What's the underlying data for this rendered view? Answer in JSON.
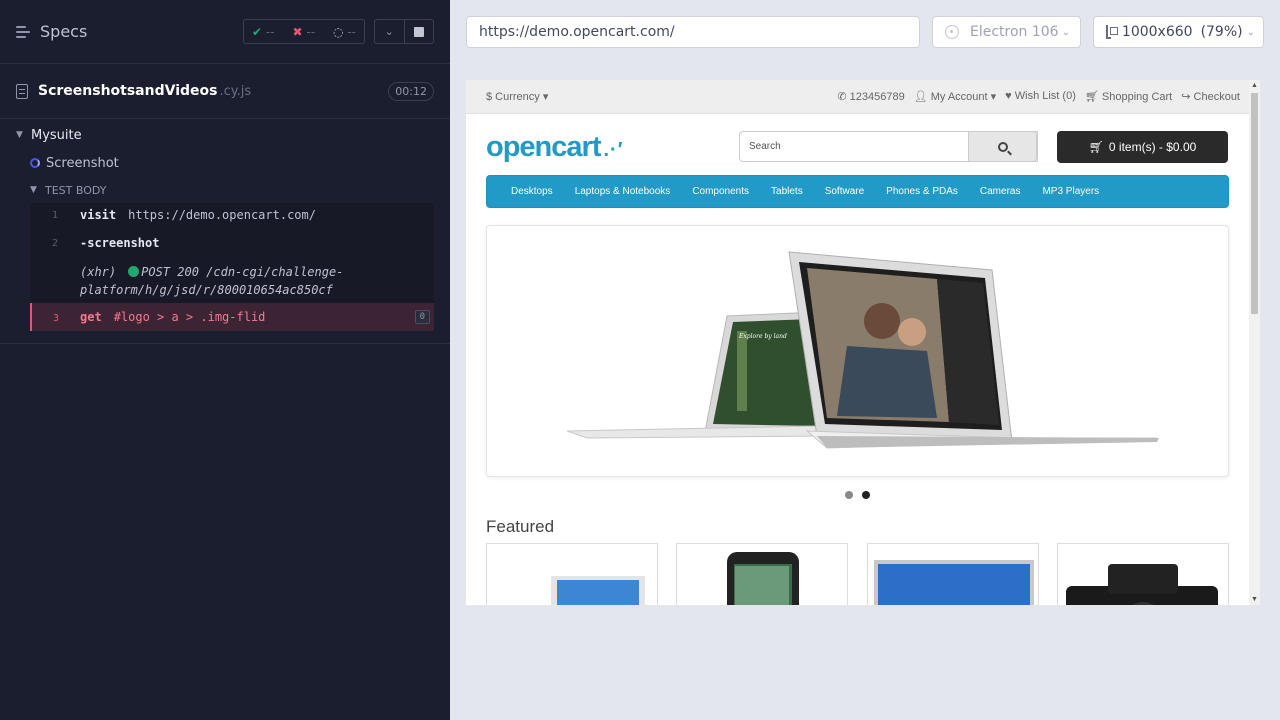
{
  "reporter": {
    "title": "Specs",
    "stats": {
      "passed": "--",
      "failed": "--",
      "pending": "--"
    },
    "spec": {
      "name": "ScreenshotsandVideos",
      "ext": ".cy.js",
      "timer": "00:12"
    },
    "suite": "Mysuite",
    "test": "Screenshot",
    "body_label": "TEST BODY",
    "commands": [
      {
        "num": "1",
        "name": "visit",
        "arg": "https://demo.opencart.com/"
      },
      {
        "num": "2",
        "name": "-screenshot",
        "arg": ""
      },
      {
        "xhr_label": "(xhr)",
        "xhr_text": "POST 200 /cdn-cgi/challenge-platform/h/g/jsd/r/800010654ac850cf"
      },
      {
        "num": "3",
        "name": "get",
        "arg": "#logo > a > .img-flid",
        "badge": "0"
      }
    ]
  },
  "toolbar": {
    "url": "https://demo.opencart.com/",
    "browser": "Electron 106",
    "viewport": "1000x660",
    "zoom": "(79%)"
  },
  "aut": {
    "currency": "$ Currency",
    "phone": "123456789",
    "account": "My Account",
    "wishlist": "Wish List (0)",
    "cart": "Shopping Cart",
    "checkout": "Checkout",
    "logo": "opencart",
    "search_placeholder": "Search",
    "cart_button": "0 item(s) - $0.00",
    "menu": [
      "Desktops",
      "Laptops & Notebooks",
      "Components",
      "Tablets",
      "Software",
      "Phones & PDAs",
      "Cameras",
      "MP3 Players"
    ],
    "featured": "Featured",
    "slide_caption": "Explore by land"
  },
  "colors": {
    "accent": "#229ac8",
    "pass": "#1fa971",
    "fail": "#e45770",
    "reporter_bg": "#1b1e2e"
  }
}
